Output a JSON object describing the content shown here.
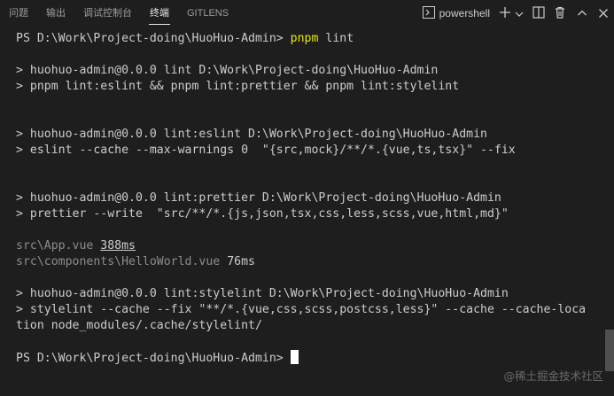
{
  "tabs": [
    {
      "label": "问题"
    },
    {
      "label": "输出"
    },
    {
      "label": "调试控制台"
    },
    {
      "label": "终端"
    },
    {
      "label": "GITLENS"
    }
  ],
  "toolbar": {
    "shell_label": "powershell",
    "icons": [
      "terminal-icon",
      "add-icon",
      "chevron-down-icon",
      "split-icon",
      "trash-icon",
      "chevron-up-icon",
      "close-icon"
    ]
  },
  "terminal": {
    "prompt1": "PS D:\\Work\\Project-doing\\HuoHuo-Admin>",
    "cmd1": "pnpm",
    "cmd1_args": "lint",
    "lint_header": "> huohuo-admin@0.0.0 lint D:\\Work\\Project-doing\\HuoHuo-Admin",
    "lint_cmd": "> pnpm lint:eslint && pnpm lint:prettier && pnpm lint:stylelint",
    "eslint_header": "> huohuo-admin@0.0.0 lint:eslint D:\\Work\\Project-doing\\HuoHuo-Admin",
    "eslint_cmd": "> eslint --cache --max-warnings 0  \"{src,mock}/**/*.{vue,ts,tsx}\" --fix",
    "prettier_header": "> huohuo-admin@0.0.0 lint:prettier D:\\Work\\Project-doing\\HuoHuo-Admin",
    "prettier_cmd": "> prettier --write  \"src/**/*.{js,json,tsx,css,less,scss,vue,html,md}\"",
    "file1_path": "src\\App.vue",
    "file1_time": "388ms",
    "file2_path": "src\\components\\HelloWorld.vue",
    "file2_time": "76ms",
    "stylelint_header": "> huohuo-admin@0.0.0 lint:stylelint D:\\Work\\Project-doing\\HuoHuo-Admin",
    "stylelint_cmd_1": "> stylelint --cache --fix \"**/*.{vue,css,scss,postcss,less}\" --cache --cache-loca",
    "stylelint_cmd_2": "tion node_modules/.cache/stylelint/",
    "prompt2": "PS D:\\Work\\Project-doing\\HuoHuo-Admin>"
  },
  "watermark": "@稀土掘金技术社区"
}
